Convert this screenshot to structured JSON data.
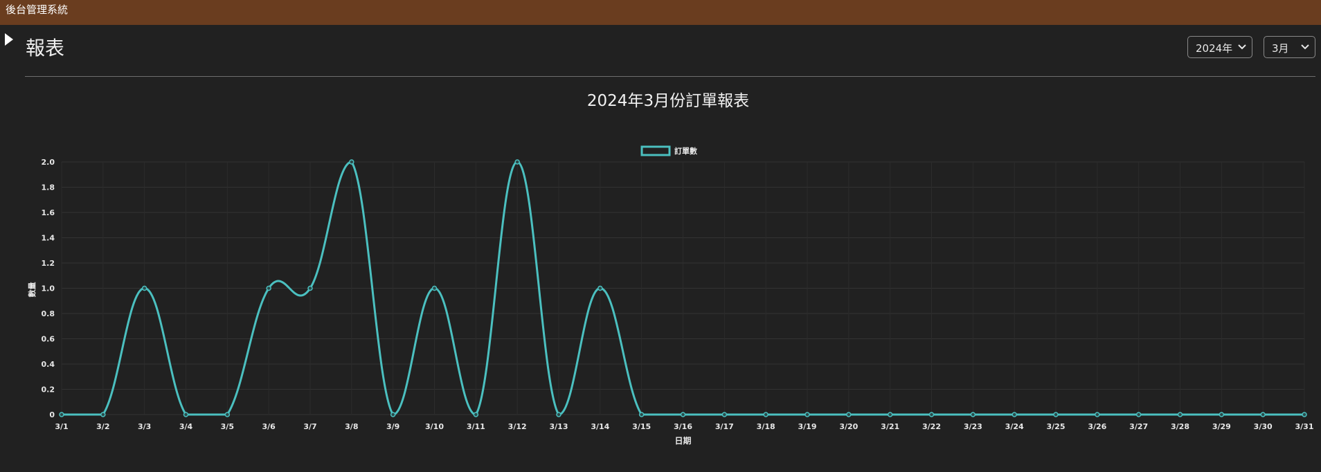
{
  "app": {
    "title": "後台管理系統"
  },
  "header": {
    "toggle_icon": "caret-right-icon"
  },
  "page": {
    "title": "報表"
  },
  "filters": {
    "year": {
      "selected": "2024年",
      "icon": "chevron-down-icon"
    },
    "month": {
      "selected": "3月",
      "icon": "chevron-down-icon"
    }
  },
  "colors": {
    "topbar": "#6a3d1f",
    "background": "#212121",
    "series": "#4bc0c0"
  },
  "chart_data": {
    "type": "line",
    "title": "2024年3月份訂單報表",
    "xlabel": "日期",
    "ylabel": "數量",
    "legend_position": "top-center",
    "grid": true,
    "ylim": [
      0,
      2
    ],
    "yticks": [
      "0",
      "0.2",
      "0.4",
      "0.6",
      "0.8",
      "1.0",
      "1.2",
      "1.4",
      "1.6",
      "1.8",
      "2.0"
    ],
    "categories": [
      "3/1",
      "3/2",
      "3/3",
      "3/4",
      "3/5",
      "3/6",
      "3/7",
      "3/8",
      "3/9",
      "3/10",
      "3/11",
      "3/12",
      "3/13",
      "3/14",
      "3/15",
      "3/16",
      "3/17",
      "3/18",
      "3/19",
      "3/20",
      "3/21",
      "3/22",
      "3/23",
      "3/24",
      "3/25",
      "3/26",
      "3/27",
      "3/28",
      "3/29",
      "3/30",
      "3/31"
    ],
    "series": [
      {
        "name": "訂單數",
        "values": [
          0,
          0,
          1,
          0,
          0,
          1,
          1,
          2,
          0,
          1,
          0,
          2,
          0,
          1,
          0,
          0,
          0,
          0,
          0,
          0,
          0,
          0,
          0,
          0,
          0,
          0,
          0,
          0,
          0,
          0,
          0
        ]
      }
    ]
  }
}
